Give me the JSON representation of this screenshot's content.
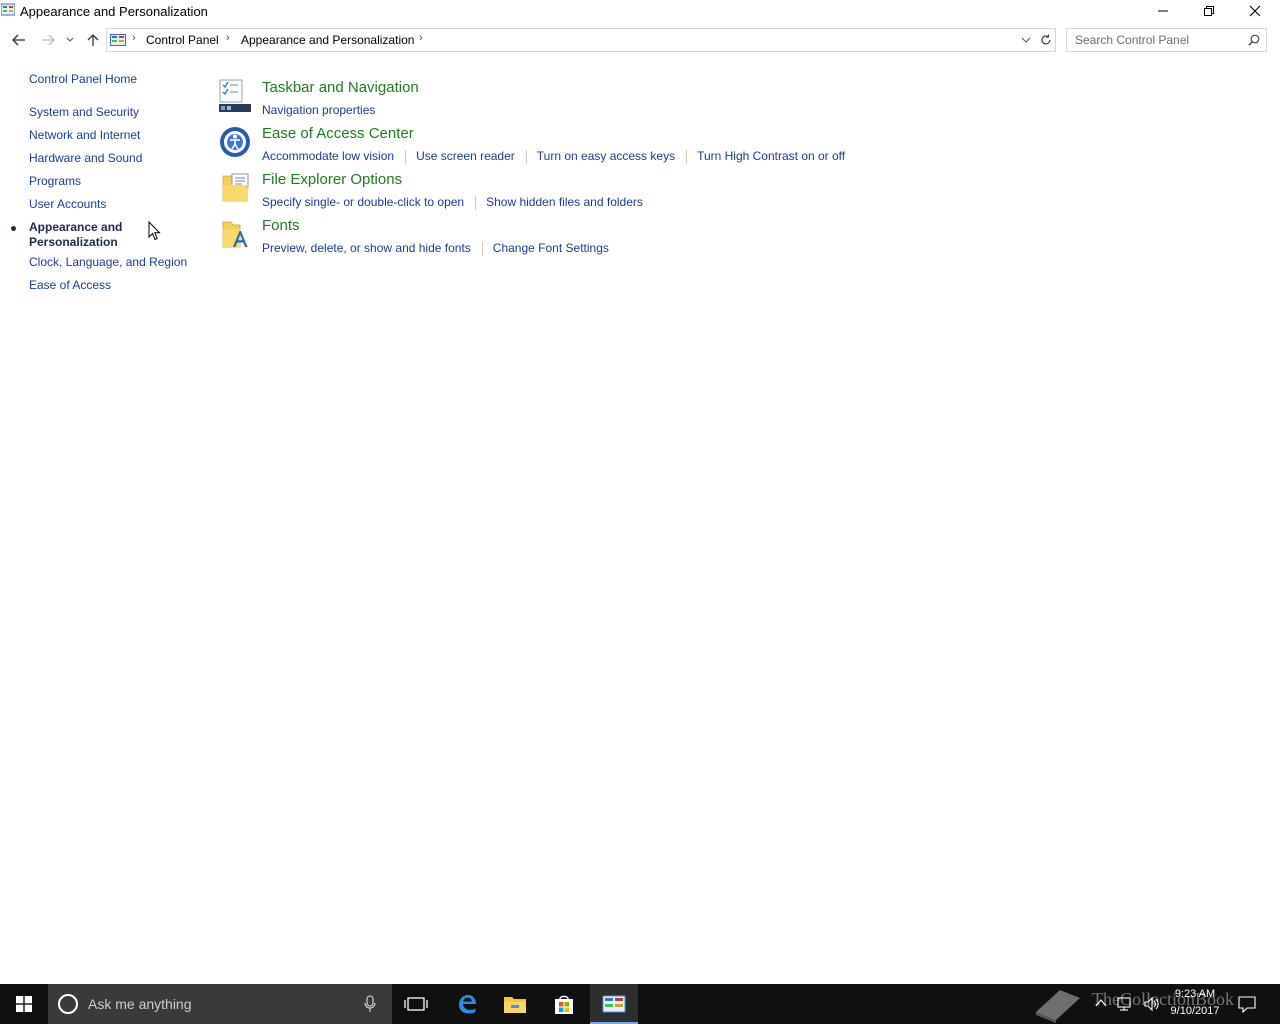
{
  "window": {
    "title": "Appearance and Personalization"
  },
  "navigation": {
    "breadcrumbs": [
      "Control Panel",
      "Appearance and Personalization"
    ],
    "search_placeholder": "Search Control Panel"
  },
  "left_nav": {
    "home": "Control Panel Home",
    "items": [
      "System and Security",
      "Network and Internet",
      "Hardware and Sound",
      "Programs",
      "User Accounts"
    ],
    "current": "Appearance and Personalization",
    "items_after": [
      "Clock, Language, and Region",
      "Ease of Access"
    ]
  },
  "categories": [
    {
      "title": "Taskbar and Navigation",
      "icon": "taskbar-icon",
      "links": [
        "Navigation properties"
      ]
    },
    {
      "title": "Ease of Access Center",
      "icon": "ease-of-access-icon",
      "links": [
        "Accommodate low vision",
        "Use screen reader",
        "Turn on easy access keys",
        "Turn High Contrast on or off"
      ]
    },
    {
      "title": "File Explorer Options",
      "icon": "folder-options-icon",
      "links": [
        "Specify single- or double-click to open",
        "Show hidden files and folders"
      ]
    },
    {
      "title": "Fonts",
      "icon": "fonts-icon",
      "links": [
        "Preview, delete, or show and hide fonts",
        "Change Font Settings"
      ]
    }
  ],
  "taskbar": {
    "search_text": "Ask me anything",
    "time": "9:23 AM",
    "date": "9/10/2017",
    "watermark": "TheCollectionBook"
  },
  "colors": {
    "link": "#1a3c99",
    "category_title": "#1e7c1e",
    "taskbar": "#101010",
    "accent": "#7aa7e6"
  }
}
